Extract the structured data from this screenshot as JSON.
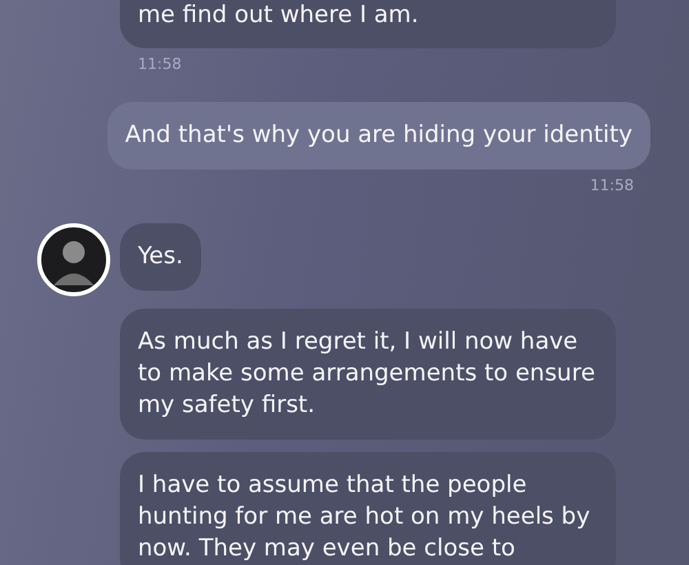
{
  "messages": [
    {
      "kind": "received",
      "text": "me find out where I am.",
      "time": "11:58",
      "avatar": false
    },
    {
      "kind": "sent",
      "text": "And that's why you are hiding your identity",
      "time": "11:58",
      "avatar": false
    },
    {
      "kind": "received",
      "text": "Yes.",
      "avatar": true
    },
    {
      "kind": "received",
      "text": "As much as I regret it, I will now have to make some arrangements to ensure my safety first.",
      "avatar": false
    },
    {
      "kind": "received",
      "text": "I have to assume that the people hunting for me are hot on my heels by now. They may even be close to",
      "avatar": false
    }
  ]
}
